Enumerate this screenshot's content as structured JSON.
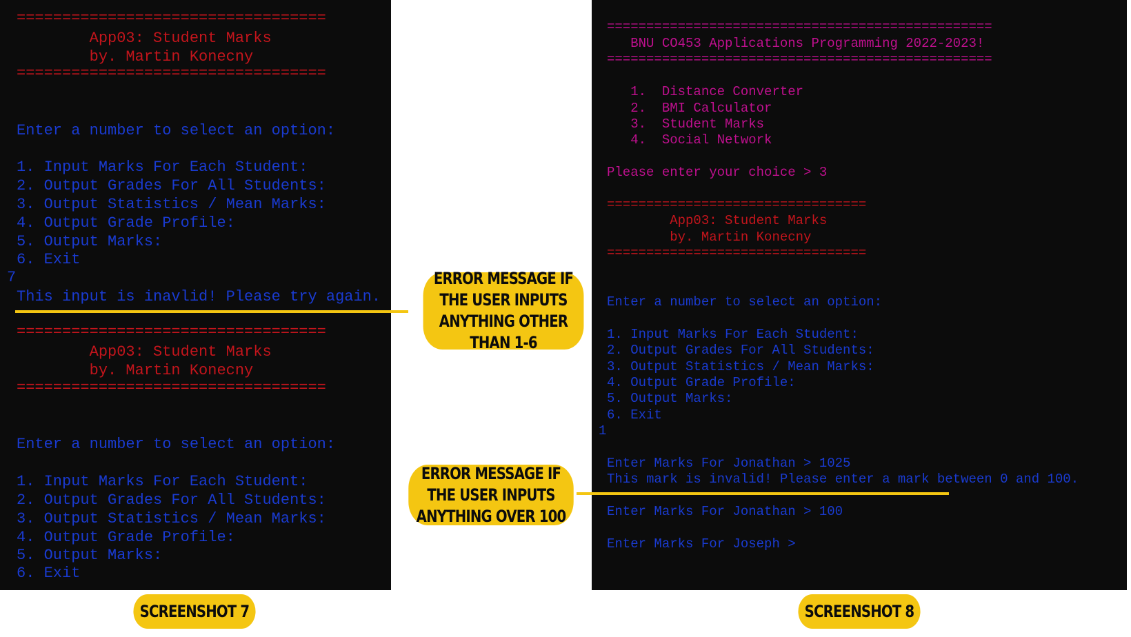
{
  "screenshot7": {
    "label": "SCREENSHOT 7",
    "lines": [
      "==================================",
      "        App03: Student Marks",
      "        by. Martin Konecny",
      "==================================",
      "Enter a number to select an option:",
      "1. Input Marks For Each Student:",
      "2. Output Grades For All Students:",
      "3. Output Statistics / Mean Marks:",
      "4. Output Grade Profile:",
      "5. Output Marks:",
      "6. Exit",
      "7",
      "This input is inavlid! Please try again.",
      "==================================",
      "        App03: Student Marks",
      "        by. Martin Konecny",
      "==================================",
      "Enter a number to select an option:",
      "1. Input Marks For Each Student:",
      "2. Output Grades For All Students:",
      "3. Output Statistics / Mean Marks:",
      "4. Output Grade Profile:",
      "5. Output Marks:",
      "6. Exit"
    ]
  },
  "screenshot8": {
    "label": "SCREENSHOT 8",
    "lines": [
      "=================================================",
      "   BNU CO453 Applications Programming 2022-2023!",
      "=================================================",
      "   1.  Distance Converter",
      "   2.  BMI Calculator",
      "   3.  Student Marks",
      "   4.  Social Network",
      "Please enter your choice > 3",
      "=================================",
      "        App03: Student Marks",
      "        by. Martin Konecny",
      "=================================",
      "Enter a number to select an option:",
      "1. Input Marks For Each Student:",
      "2. Output Grades For All Students:",
      "3. Output Statistics / Mean Marks:",
      "4. Output Grade Profile:",
      "5. Output Marks:",
      "6. Exit",
      "1",
      "Enter Marks For Jonathan > 1025",
      "This mark is invalid! Please enter a mark between 0 and 100.",
      "Enter Marks For Jonathan > 100",
      "Enter Marks For Joseph >"
    ]
  },
  "callouts": {
    "invalid_option": "ERROR MESSAGE IF THE USER INPUTS ANYTHING OTHER THAN 1-6",
    "invalid_mark": "ERROR MESSAGE IF THE USER INPUTS ANYTHING OVER 100"
  },
  "colors": {
    "console_bg": "#0c0c0c",
    "header_red": "#c4151c",
    "menu_blue": "#1a3bd1",
    "title_magenta": "#c0108f",
    "callout_yellow": "#f4c612"
  }
}
